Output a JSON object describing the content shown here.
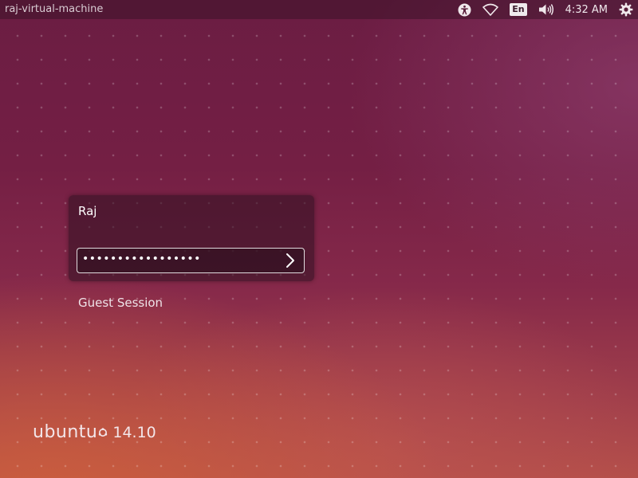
{
  "panel": {
    "hostname": "raj-virtual-machine",
    "keyboard_layout": "En",
    "clock": "4:32 AM",
    "icons": [
      "accessibility-icon",
      "wifi-icon",
      "keyboard-layout-indicator",
      "volume-icon",
      "power-gear-icon"
    ]
  },
  "login": {
    "user_name": "Raj",
    "password_masked": "•••••••••••••••••"
  },
  "guest_session": "Guest Session",
  "branding": {
    "name": "ubuntu",
    "version": "14.10"
  }
}
